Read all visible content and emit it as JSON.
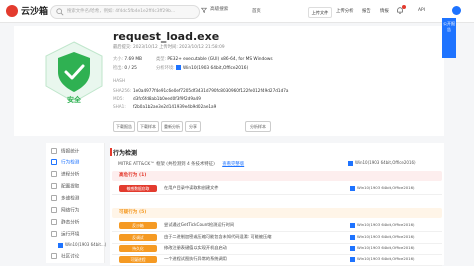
{
  "brand": {
    "name": "云沙箱"
  },
  "search": {
    "placeholder": "搜索文件名/哈希，例如: 4f4dc5fb4e1e2ff4c3ff29b..."
  },
  "header": {
    "advanced_search": "高级搜索",
    "nav": [
      "首页",
      "上传分析",
      "报告",
      "情报",
      "API"
    ],
    "upload_label": "上传文件"
  },
  "side_ribbon": "公开报告",
  "file": {
    "title": "request_load.exe",
    "meta_line": "最后提交: 2023/10/12      上传时间: 2023/10/12 21:58:09",
    "size_label": "大小:",
    "size_value": "7.69 MB",
    "type_label": "类型:",
    "type_value": "PE32+ executable (GUI) x86-64, for MS Windows",
    "detect_label": "检出:",
    "detect_value": "0 / 25",
    "env_label": "分析环境:",
    "env_value": "Win10(1903 64bit,Office2016)",
    "verdict": "安全"
  },
  "hashes": {
    "heading": "HASH",
    "rows": [
      {
        "label": "SHA256:",
        "value": "1e0a4977f4e91c6e0ef7205df3431d790fc8030960f122fe012f49d27d1d7a"
      },
      {
        "label": "MD5:",
        "value": "d3fc6fd8ab1b0eed0f3f9f2d9a49"
      },
      {
        "label": "SHA1:",
        "value": "f2b0a1b2ae3e2d141939e4b9d02ae1a9"
      }
    ]
  },
  "actions": [
    "下载报告",
    "下载样本",
    "重新分析",
    "分享",
    "分析样本"
  ],
  "sidebar": {
    "items": [
      "情报统计",
      "行为检测",
      "进程分析",
      "配置提取",
      "多维检测",
      "网络行为",
      "静态分析",
      "运行环境",
      "Win10(1903 64bit...)",
      "社区讨论"
    ]
  },
  "behavior": {
    "title": "行为检测",
    "attck_line": "MITRE ATT&CK™ 框架  (共检测到 4 条技术特征)",
    "attck_link": "查看完整版",
    "env_tag": "Win10(1903 64bit,Office2016)",
    "groups": [
      {
        "label": "高危行为 (1)",
        "color": "#e33b2e",
        "bg": "#fdeeee",
        "rows": [
          {
            "pill": "敏感数据窃取",
            "desc": "在用户目录中读取和创建文件",
            "env": "Win10(1903 64bit,Office2016)"
          }
        ]
      },
      {
        "label": "可疑行为 (5)",
        "color": "#f59a23",
        "bg": "#fff5e8",
        "rows": [
          {
            "pill": "反沙箱",
            "desc": "尝试通过GetTickCount检测运行时间",
            "env": "Win10(1903 64bit,Office2016)"
          },
          {
            "pill": "反调试",
            "desc": "由于二进制加密或压缩可能包含未知代码混淆: 可能被压缩",
            "env": "Win10(1903 64bit,Office2016)"
          },
          {
            "pill": "持久化",
            "desc": "修改注册表键值以实现开机自启动",
            "env": "Win10(1903 64bit,Office2016)"
          },
          {
            "pill": "可疑进程",
            "desc": "一个进程试图执行异常的系统调用",
            "env": "Win10(1903 64bit,Office2016)"
          }
        ]
      }
    ]
  },
  "colors": {
    "accent": "#1e73ff",
    "safe": "#2fb152",
    "danger": "#e33b2e",
    "warning": "#f59a23"
  }
}
